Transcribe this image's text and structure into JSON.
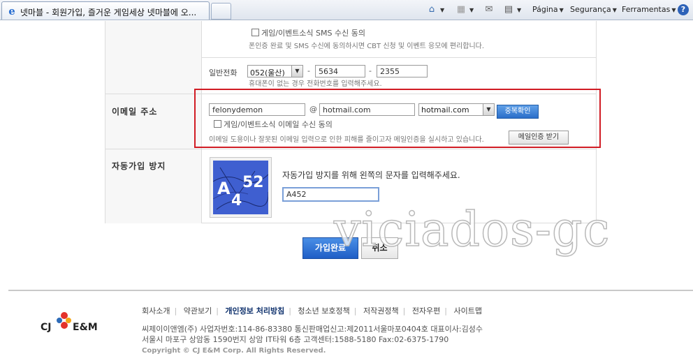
{
  "browser": {
    "tab_title": "넷마블 - 회원가입, 즐거운 게임세상 넷마블에 오...",
    "menu": {
      "page": "Página",
      "security": "Segurança",
      "tools": "Ferramentas"
    }
  },
  "form": {
    "sms": {
      "checkbox_label": "게임/이벤트소식 SMS 수신 동의",
      "help": "폰인증 완료 및 SMS 수신에 동의하시면 CBT 신청 및 이벤트 응모에 편리합니다."
    },
    "phone": {
      "label": "일반전화",
      "area_code": "052(울산)",
      "part2": "5634",
      "dash": "-",
      "part3": "2355",
      "help": "휴대폰이 없는 경우 전화번호를 입력해주세요."
    },
    "email": {
      "label": "이메일 주소",
      "id_value": "felonydemon",
      "at": "@",
      "domain_value": "hotmail.com",
      "domain_select": "hotmail.com",
      "check_button": "중복확인",
      "checkbox_label": "게임/이벤트소식 이메일 수신 동의",
      "help": "이메일 도용이나 잘못된 이메일 입력으로 인한 피해를 줄이고자 메일인증을 실시하고 있습니다.",
      "verify_button": "메일인증 받기"
    },
    "captcha": {
      "label": "자동가입 방지",
      "instruction": "자동가입 방지를 위해 왼쪽의 문자를 입력해주세요.",
      "image_text": "A452",
      "input_value": "A452"
    },
    "submit_button": "가입완료",
    "cancel_button": "취소"
  },
  "watermark": "viciados-gc",
  "footer": {
    "logo_cj": "CJ",
    "logo_em": "E&M",
    "links": [
      "회사소개",
      "약관보기",
      "개인정보 처리방침",
      "청소년 보호정책",
      "저작권정책",
      "전자우편",
      "사이트맵"
    ],
    "info_line1": "씨제이이앤엠(주) 사업자번호:114-86-83380 통신판매업신고:제2011서울마포0404호 대표이사:김성수",
    "info_line2": "서울시 마포구 상암동 1590번지 상암 IT타워 6층 고객센터:1588-5180 Fax:02-6375-1790",
    "copyright": "Copyright © CJ E&M Corp. All Rights Reserved."
  }
}
